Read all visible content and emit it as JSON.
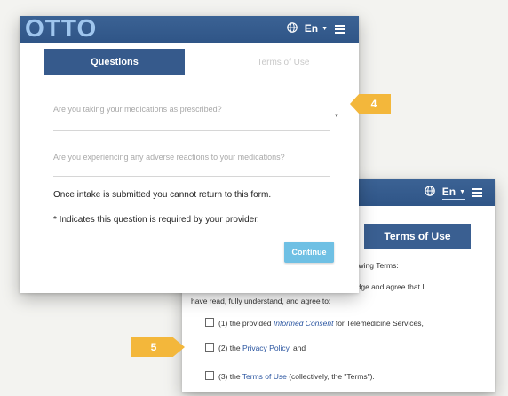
{
  "header": {
    "logo": "OTTO",
    "language": "En"
  },
  "questions_form": {
    "tabs": [
      {
        "label": "Questions",
        "active": true
      },
      {
        "label": "Terms of Use",
        "active": false
      }
    ],
    "fields": [
      {
        "placeholder": "Are you taking your medications as prescribed?",
        "type": "select"
      },
      {
        "placeholder": "Are you experiencing any adverse reactions to your medications?",
        "type": "text"
      }
    ],
    "notes": [
      "Once intake is submitted you cannot return to this form.",
      "* Indicates this question is required by your provider."
    ],
    "continue_label": "Continue"
  },
  "terms_panel": {
    "language": "En",
    "active_tab": "Terms of Use",
    "lines": [
      "llowing Terms:",
      "ledge and agree that I",
      "have read, fully understand, and agree to:"
    ],
    "items": [
      {
        "prefix": "(1) the provided ",
        "link": "Informed Consent",
        "suffix": " for Telemedicine Services,"
      },
      {
        "prefix": "(2) the ",
        "link": "Privacy Policy",
        "suffix": ", and"
      },
      {
        "prefix": "(3) the ",
        "link": "Terms of Use",
        "suffix": " (collectively, the \"Terms\")."
      }
    ]
  },
  "callouts": [
    "4",
    "5"
  ],
  "colors": {
    "header_blue": "#2f5587",
    "tab_blue": "#365a8c",
    "logo_light_blue": "#9fc6ee",
    "continue_button": "#6fc0e4",
    "callout_orange": "#f3b73b",
    "link_blue": "#2a55a0"
  }
}
